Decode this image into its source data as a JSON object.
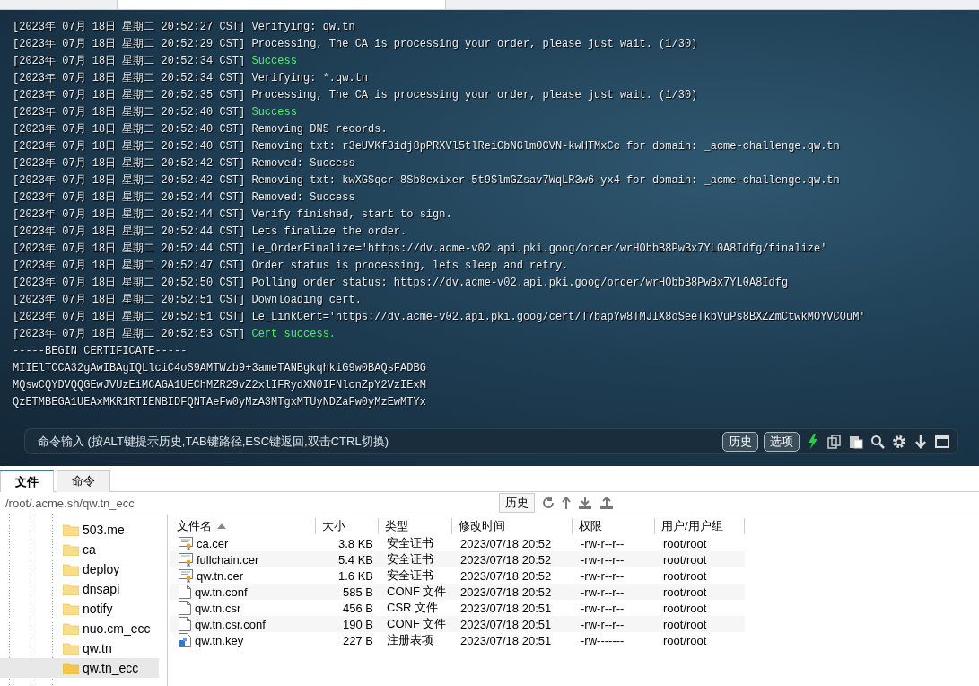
{
  "log": [
    {
      "kind": "log",
      "time": "[2023年 07月 18日 星期二 20:52:27 CST]",
      "message": "Verifying: qw.tn",
      "success": false
    },
    {
      "kind": "log",
      "time": "[2023年 07月 18日 星期二 20:52:29 CST]",
      "message": "Processing, The CA is processing your order, please just wait. (1/30)",
      "success": false
    },
    {
      "kind": "log",
      "time": "[2023年 07月 18日 星期二 20:52:34 CST]",
      "message": "Success",
      "success": true
    },
    {
      "kind": "log",
      "time": "[2023年 07月 18日 星期二 20:52:34 CST]",
      "message": "Verifying: *.qw.tn",
      "success": false
    },
    {
      "kind": "log",
      "time": "[2023年 07月 18日 星期二 20:52:35 CST]",
      "message": "Processing, The CA is processing your order, please just wait. (1/30)",
      "success": false
    },
    {
      "kind": "log",
      "time": "[2023年 07月 18日 星期二 20:52:40 CST]",
      "message": "Success",
      "success": true
    },
    {
      "kind": "log",
      "time": "[2023年 07月 18日 星期二 20:52:40 CST]",
      "message": "Removing DNS records.",
      "success": false
    },
    {
      "kind": "log",
      "time": "[2023年 07月 18日 星期二 20:52:40 CST]",
      "message": "Removing txt: r3eUVKf3idj8pPRXVl5tlReiCbNGlmOGVN-kwHTMxCc for domain: _acme-challenge.qw.tn",
      "success": false
    },
    {
      "kind": "log",
      "time": "[2023年 07月 18日 星期二 20:52:42 CST]",
      "message": "Removed: Success",
      "success": false
    },
    {
      "kind": "log",
      "time": "[2023年 07月 18日 星期二 20:52:42 CST]",
      "message": "Removing txt: kwXGSqcr-8Sb8exixer-5t9SlmGZsav7WqLR3w6-yx4 for domain: _acme-challenge.qw.tn",
      "success": false
    },
    {
      "kind": "log",
      "time": "[2023年 07月 18日 星期二 20:52:44 CST]",
      "message": "Removed: Success",
      "success": false
    },
    {
      "kind": "log",
      "time": "[2023年 07月 18日 星期二 20:52:44 CST]",
      "message": "Verify finished, start to sign.",
      "success": false
    },
    {
      "kind": "log",
      "time": "[2023年 07月 18日 星期二 20:52:44 CST]",
      "message": "Lets finalize the order.",
      "success": false
    },
    {
      "kind": "log",
      "time": "[2023年 07月 18日 星期二 20:52:44 CST]",
      "message": "Le_OrderFinalize='https://dv.acme-v02.api.pki.goog/order/wrHObbB8PwBx7YL0A8Idfg/finalize'",
      "success": false
    },
    {
      "kind": "log",
      "time": "[2023年 07月 18日 星期二 20:52:47 CST]",
      "message": "Order status is processing, lets sleep and retry.",
      "success": false
    },
    {
      "kind": "log",
      "time": "[2023年 07月 18日 星期二 20:52:50 CST]",
      "message": "Polling order status: https://dv.acme-v02.api.pki.goog/order/wrHObbB8PwBx7YL0A8Idfg",
      "success": false
    },
    {
      "kind": "log",
      "time": "[2023年 07月 18日 星期二 20:52:51 CST]",
      "message": "Downloading cert.",
      "success": false
    },
    {
      "kind": "log",
      "time": "[2023年 07月 18日 星期二 20:52:51 CST]",
      "message": "Le_LinkCert='https://dv.acme-v02.api.pki.goog/cert/T7bapYw8TMJIX8oSeeTkbVuPs8BXZZmCtwkMOYVCOuM'",
      "success": false
    },
    {
      "kind": "log",
      "time": "[2023年 07月 18日 星期二 20:52:53 CST]",
      "message": "Cert success.",
      "success": true
    },
    {
      "kind": "plain",
      "message": "-----BEGIN CERTIFICATE-----"
    },
    {
      "kind": "plain",
      "message": "MIIElTCCA32gAwIBAgIQLlciC4oS9AMTWzb9+3ameTANBgkqhkiG9w0BAQsFADBG"
    },
    {
      "kind": "plain",
      "message": "MQswCQYDVQQGEwJVUzEiMCAGA1UEChMZR29vZ2xlIFRydXN0IFNlcnZpY2VzIExM"
    },
    {
      "kind": "plain",
      "message": "QzETMBEGA1UEAxMKR1RTIENBIDFQNTAeFw0yMzA3MTgxMTUyNDZaFw0yMzEwMTYx"
    }
  ],
  "command_bar": {
    "placeholder": "命令输入 (按ALT键提示历史,TAB键路径,ESC键返回,双击CTRL切换)",
    "buttons": [
      "历史",
      "选项"
    ]
  },
  "tabs": [
    {
      "label": "文件",
      "selected": true
    },
    {
      "label": "命令",
      "selected": false
    }
  ],
  "path_bar": {
    "path": "/root/.acme.sh/qw.tn_ecc",
    "history_button": "历史"
  },
  "tree": {
    "items": [
      {
        "label": "503.me",
        "selected": false
      },
      {
        "label": "ca",
        "selected": false
      },
      {
        "label": "deploy",
        "selected": false
      },
      {
        "label": "dnsapi",
        "selected": false
      },
      {
        "label": "notify",
        "selected": false
      },
      {
        "label": "nuo.cm_ecc",
        "selected": false
      },
      {
        "label": "qw.tn",
        "selected": false
      },
      {
        "label": "qw.tn_ecc",
        "selected": true
      }
    ]
  },
  "table": {
    "columns": [
      "文件名",
      "大小",
      "类型",
      "修改时间",
      "权限",
      "用户/用户组"
    ],
    "rows": [
      {
        "kind": "cert",
        "cells": [
          "ca.cer",
          "3.8 KB",
          "安全证书",
          "2023/07/18 20:52",
          "-rw-r--r--",
          "root/root"
        ]
      },
      {
        "kind": "cert",
        "cells": [
          "fullchain.cer",
          "5.4 KB",
          "安全证书",
          "2023/07/18 20:52",
          "-rw-r--r--",
          "root/root"
        ]
      },
      {
        "kind": "cert",
        "cells": [
          "qw.tn.cer",
          "1.6 KB",
          "安全证书",
          "2023/07/18 20:52",
          "-rw-r--r--",
          "root/root"
        ]
      },
      {
        "kind": "file",
        "cells": [
          "qw.tn.conf",
          "585 B",
          "CONF 文件",
          "2023/07/18 20:52",
          "-rw-r--r--",
          "root/root"
        ]
      },
      {
        "kind": "file",
        "cells": [
          "qw.tn.csr",
          "456 B",
          "CSR 文件",
          "2023/07/18 20:51",
          "-rw-r--r--",
          "root/root"
        ]
      },
      {
        "kind": "file",
        "cells": [
          "qw.tn.csr.conf",
          "190 B",
          "CONF 文件",
          "2023/07/18 20:51",
          "-rw-r--r--",
          "root/root"
        ]
      },
      {
        "kind": "key",
        "cells": [
          "qw.tn.key",
          "227 B",
          "注册表项",
          "2023/07/18 20:51",
          "-rw-------",
          "root/root"
        ]
      }
    ]
  }
}
